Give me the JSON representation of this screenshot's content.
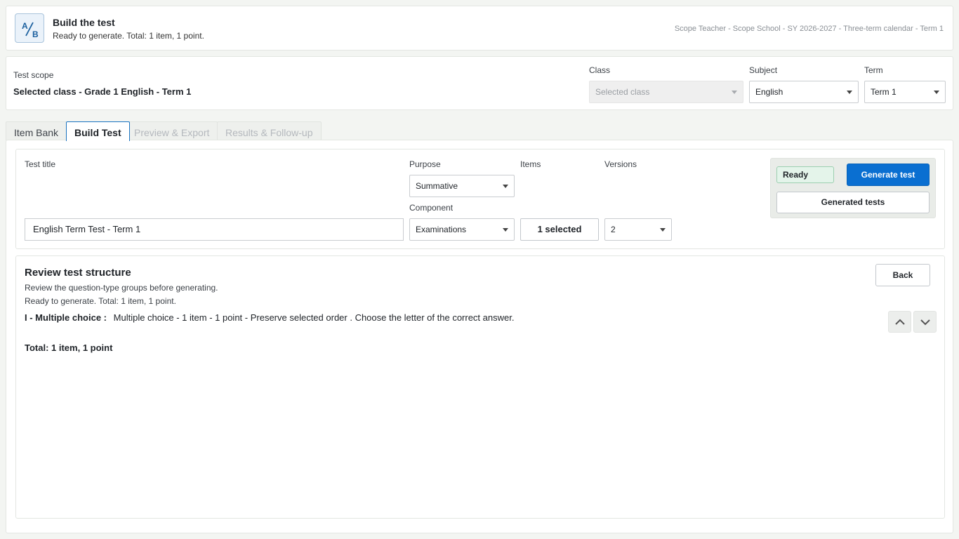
{
  "header": {
    "logo_icon": "ab-test-icon",
    "title": "Build the test",
    "subtitle": "Ready to generate. Total: 1 item, 1 point.",
    "context": "Scope Teacher - Scope School - SY 2026-2027 - Three-term calendar - Term 1"
  },
  "scope": {
    "label": "Test scope",
    "value": "Selected class - Grade 1 English - Term 1",
    "class_label": "Class",
    "class_value": "Selected class",
    "subject_label": "Subject",
    "subject_value": "English",
    "term_label": "Term",
    "term_value": "Term 1"
  },
  "tabs": [
    {
      "label": "Item Bank",
      "state": "normal"
    },
    {
      "label": "Build Test",
      "state": "active"
    },
    {
      "label": "Preview & Export",
      "state": "disabled"
    },
    {
      "label": "Results & Follow-up",
      "state": "disabled"
    }
  ],
  "form": {
    "title_label": "Test title",
    "title_value": "English Term Test - Term 1",
    "purpose_label": "Purpose",
    "purpose_value": "Summative",
    "component_label": "Component",
    "component_value": "Examinations",
    "items_label": "Items",
    "items_value": "1 selected",
    "versions_label": "Versions",
    "versions_value": "2",
    "status_badge": "Ready",
    "generate_label": "Generate test",
    "generated_label": "Generated tests"
  },
  "review": {
    "title": "Review test structure",
    "subtitle": "Review the question-type groups before generating.",
    "status": "Ready to generate. Total: 1 item, 1 point.",
    "back_label": "Back",
    "group_name": "I - Multiple choice :",
    "group_detail": "Multiple choice - 1 item - 1 point - Preserve selected order .  Choose the letter of the correct answer.",
    "total": "Total: 1 item, 1 point"
  },
  "colors": {
    "accent": "#0a6fd1",
    "ready_bg": "#e4f4ea",
    "ready_border": "#9ccfb0",
    "page_bg": "#f3f5f2"
  }
}
